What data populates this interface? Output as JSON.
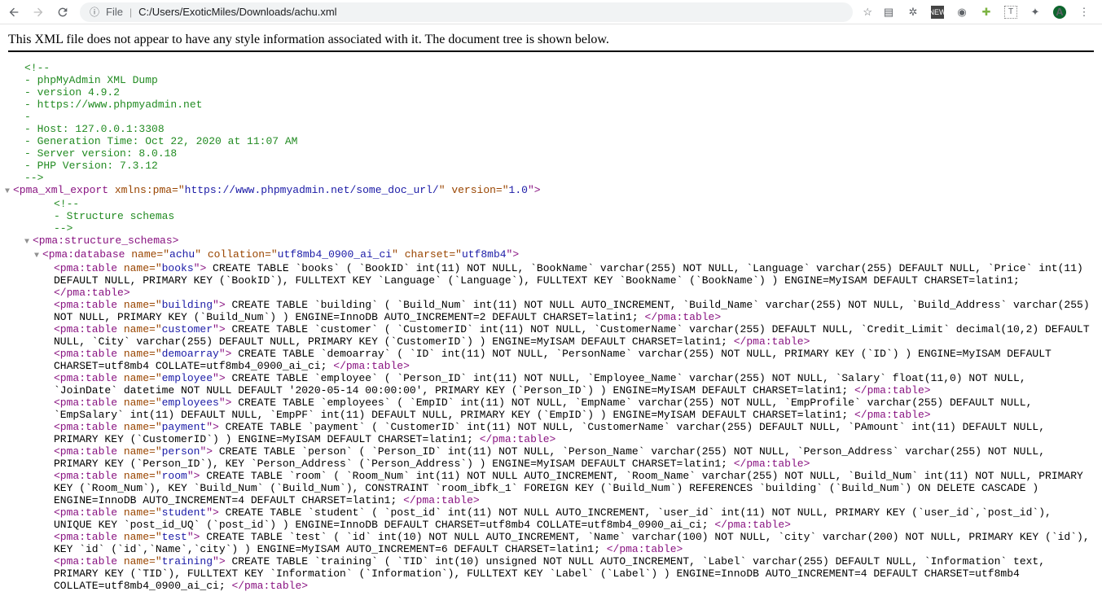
{
  "toolbar": {
    "file_label": "File",
    "url": "C:/Users/ExoticMiles/Downloads/achu.xml",
    "avatar_letter": "A"
  },
  "notice": "This XML file does not appear to have any style information associated with it. The document tree is shown below.",
  "comment_lines": [
    "<!--",
    "- phpMyAdmin XML Dump",
    "- version 4.9.2",
    "- https://www.phpmyadmin.net",
    "-",
    "- Host: 127.0.0.1:3308",
    "- Generation Time: Oct 22, 2020 at 11:07 AM",
    "- Server version: 8.0.18",
    "- PHP Version: 7.3.12",
    "-->"
  ],
  "root": {
    "tag_open": "<pma_xml_export",
    "attr1_name": " xmlns:pma=\"",
    "attr1_val": "https://www.phpmyadmin.net/some_doc_url/",
    "attr2_name": "\" version=\"",
    "attr2_val": "1.0",
    "close": "\">"
  },
  "inner_comment": [
    "<!--",
    "- Structure schemas",
    "-->"
  ],
  "schemas_open": "<pma:structure_schemas>",
  "db": {
    "open_tag": "<pma:database",
    "attr_name_name": " name=\"",
    "attr_name_val": "achu",
    "attr_coll_name": "\" collation=\"",
    "attr_coll_val": "utf8mb4_0900_ai_ci",
    "attr_charset_name": "\" charset=\"",
    "attr_charset_val": "utf8mb4",
    "close": "\">"
  },
  "tables": [
    {
      "name": "books",
      "sql": " CREATE TABLE `books` ( `BookID` int(11) NOT NULL, `BookName` varchar(255) NOT NULL, `Language` varchar(255) DEFAULT NULL, `Price` int(11) DEFAULT NULL, PRIMARY KEY (`BookID`), FULLTEXT KEY `Language` (`Language`), FULLTEXT KEY `BookName` (`BookName`) ) ENGINE=MyISAM DEFAULT CHARSET=latin1; "
    },
    {
      "name": "building",
      "sql": " CREATE TABLE `building` ( `Build_Num` int(11) NOT NULL AUTO_INCREMENT, `Build_Name` varchar(255) NOT NULL, `Build_Address` varchar(255) NOT NULL, PRIMARY KEY (`Build_Num`) ) ENGINE=InnoDB AUTO_INCREMENT=2 DEFAULT CHARSET=latin1; "
    },
    {
      "name": "customer",
      "sql": " CREATE TABLE `customer` ( `CustomerID` int(11) NOT NULL, `CustomerName` varchar(255) DEFAULT NULL, `Credit_Limit` decimal(10,2) DEFAULT NULL, `City` varchar(255) DEFAULT NULL, PRIMARY KEY (`CustomerID`) ) ENGINE=MyISAM DEFAULT CHARSET=latin1; "
    },
    {
      "name": "demoarray",
      "sql": " CREATE TABLE `demoarray` ( `ID` int(11) NOT NULL, `PersonName` varchar(255) NOT NULL, PRIMARY KEY (`ID`) ) ENGINE=MyISAM DEFAULT CHARSET=utf8mb4 COLLATE=utf8mb4_0900_ai_ci; "
    },
    {
      "name": "employee",
      "sql": " CREATE TABLE `employee` ( `Person_ID` int(11) NOT NULL, `Employee_Name` varchar(255) NOT NULL, `Salary` float(11,0) NOT NULL, `JoinDate` datetime NOT NULL DEFAULT '2020-05-14 00:00:00', PRIMARY KEY (`Person_ID`) ) ENGINE=MyISAM DEFAULT CHARSET=latin1; "
    },
    {
      "name": "employees",
      "sql": " CREATE TABLE `employees` ( `EmpID` int(11) NOT NULL, `EmpName` varchar(255) NOT NULL, `EmpProfile` varchar(255) DEFAULT NULL, `EmpSalary` int(11) DEFAULT NULL, `EmpPF` int(11) DEFAULT NULL, PRIMARY KEY (`EmpID`) ) ENGINE=MyISAM DEFAULT CHARSET=latin1; "
    },
    {
      "name": "payment",
      "sql": " CREATE TABLE `payment` ( `CustomerID` int(11) NOT NULL, `CustomerName` varchar(255) DEFAULT NULL, `PAmount` int(11) DEFAULT NULL, PRIMARY KEY (`CustomerID`) ) ENGINE=MyISAM DEFAULT CHARSET=latin1; "
    },
    {
      "name": "person",
      "sql": " CREATE TABLE `person` ( `Person_ID` int(11) NOT NULL, `Person_Name` varchar(255) NOT NULL, `Person_Address` varchar(255) NOT NULL, PRIMARY KEY (`Person_ID`), KEY `Person_Address` (`Person_Address`) ) ENGINE=MyISAM DEFAULT CHARSET=latin1; "
    },
    {
      "name": "room",
      "sql": " CREATE TABLE `room` ( `Room_Num` int(11) NOT NULL AUTO_INCREMENT, `Room_Name` varchar(255) NOT NULL, `Build_Num` int(11) NOT NULL, PRIMARY KEY (`Room_Num`), KEY `Build_Num` (`Build_Num`), CONSTRAINT `room_ibfk_1` FOREIGN KEY (`Build_Num`) REFERENCES `building` (`Build_Num`) ON DELETE CASCADE ) ENGINE=InnoDB AUTO_INCREMENT=4 DEFAULT CHARSET=latin1; "
    },
    {
      "name": "student",
      "sql": " CREATE TABLE `student` ( `post_id` int(11) NOT NULL AUTO_INCREMENT, `user_id` int(11) NOT NULL, PRIMARY KEY (`user_id`,`post_id`), UNIQUE KEY `post_id_UQ` (`post_id`) ) ENGINE=InnoDB DEFAULT CHARSET=utf8mb4 COLLATE=utf8mb4_0900_ai_ci; "
    },
    {
      "name": "test",
      "sql": " CREATE TABLE `test` ( `id` int(10) NOT NULL AUTO_INCREMENT, `Name` varchar(100) NOT NULL, `city` varchar(200) NOT NULL, PRIMARY KEY (`id`), KEY `id` (`id`,`Name`,`city`) ) ENGINE=MyISAM AUTO_INCREMENT=6 DEFAULT CHARSET=latin1; "
    },
    {
      "name": "training",
      "sql": " CREATE TABLE `training` ( `TID` int(10) unsigned NOT NULL AUTO_INCREMENT, `Label` varchar(255) DEFAULT NULL, `Information` text, PRIMARY KEY (`TID`), FULLTEXT KEY `Information` (`Information`), FULLTEXT KEY `Label` (`Label`) ) ENGINE=InnoDB AUTO_INCREMENT=4 DEFAULT CHARSET=utf8mb4 COLLATE=utf8mb4_0900_ai_ci; "
    }
  ],
  "table_tag_open": "<pma:table",
  "table_attr_name": " name=\"",
  "table_attr_close": "\">",
  "table_close": "</pma:table>"
}
